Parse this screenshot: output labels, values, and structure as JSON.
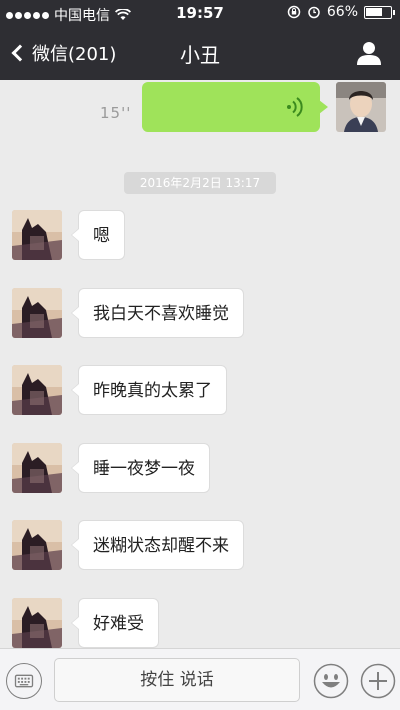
{
  "status_bar": {
    "carrier": "中国电信",
    "time": "19:57",
    "battery": "66%",
    "battery_level": 0.66,
    "icons": [
      "signal-dots-icon",
      "wifi-icon",
      "rotation-lock-icon",
      "alarm-icon",
      "battery-icon"
    ]
  },
  "nav": {
    "back_label": "微信(201)",
    "title": "小丑",
    "right_icon": "person-icon"
  },
  "chat": {
    "voice_message": {
      "duration": "15''",
      "sender": "me"
    },
    "timestamp": "2016年2月2日 13:17",
    "messages": [
      {
        "text": "嗯",
        "sender": "peer"
      },
      {
        "text": "我白天不喜欢睡觉",
        "sender": "peer"
      },
      {
        "text": "昨晚真的太累了",
        "sender": "peer"
      },
      {
        "text": "睡一夜梦一夜",
        "sender": "peer"
      },
      {
        "text": "迷糊状态却醒不来",
        "sender": "peer"
      },
      {
        "text": "好难受",
        "sender": "peer"
      }
    ]
  },
  "input_bar": {
    "hold_to_talk": "按住 说话",
    "icons": [
      "keyboard-icon",
      "emoji-icon",
      "plus-icon"
    ]
  },
  "colors": {
    "header_bg": "#2e2e33",
    "chat_bg": "#ebebeb",
    "my_bubble": "#9fe35a",
    "peer_bubble": "#ffffff"
  }
}
